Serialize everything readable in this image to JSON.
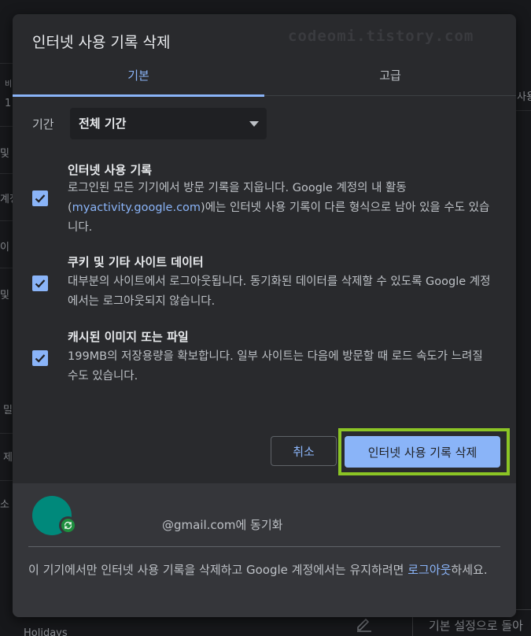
{
  "background": {
    "fragments": [
      "비",
      "1",
      "및 G",
      "계정",
      "이",
      "및 실",
      "밀",
      "제",
      "소",
      "사용",
      "Holidays",
      "기본 설정으로 돌아"
    ]
  },
  "dialog": {
    "title": "인터넷 사용 기록 삭제",
    "watermark": "codeomi.tistory.com",
    "tabs": {
      "basic": "기본",
      "advanced": "고급"
    },
    "time_range": {
      "label": "기간",
      "selected": "전체 기간"
    },
    "options": [
      {
        "title": "인터넷 사용 기록",
        "desc_before": "로그인된 모든 기기에서 방문 기록을 지웁니다. Google 계정의 내 활동 (",
        "desc_link": "myactivity.google.com",
        "desc_after": ")에는 인터넷 사용 기록이 다른 형식으로 남아 있을 수도 있습니다.",
        "checked": true
      },
      {
        "title": "쿠키 및 기타 사이트 데이터",
        "desc": "대부분의 사이트에서 로그아웃됩니다. 동기화된 데이터를 삭제할 수 있도록 Google 계정에서는 로그아웃되지 않습니다.",
        "checked": true
      },
      {
        "title": "캐시된 이미지 또는 파일",
        "desc": "199MB의 저장용량을 확보합니다. 일부 사이트는 다음에 방문할 때 로드 속도가 느려질 수도 있습니다.",
        "checked": true
      }
    ],
    "buttons": {
      "cancel": "취소",
      "delete": "인터넷 사용 기록 삭제"
    },
    "footer": {
      "account": "@gmail.com에 동기화",
      "note_before": "이 기기에서만 인터넷 사용 기록을 삭제하고 Google 계정에서는 유지하려면 ",
      "note_link": "로그아웃",
      "note_after": "하세요."
    }
  },
  "colors": {
    "accent": "#8ab4f8",
    "dialog_bg": "#292a2d",
    "footer_bg": "#35363a",
    "highlight": "#8bc425",
    "avatar": "#00897b"
  }
}
